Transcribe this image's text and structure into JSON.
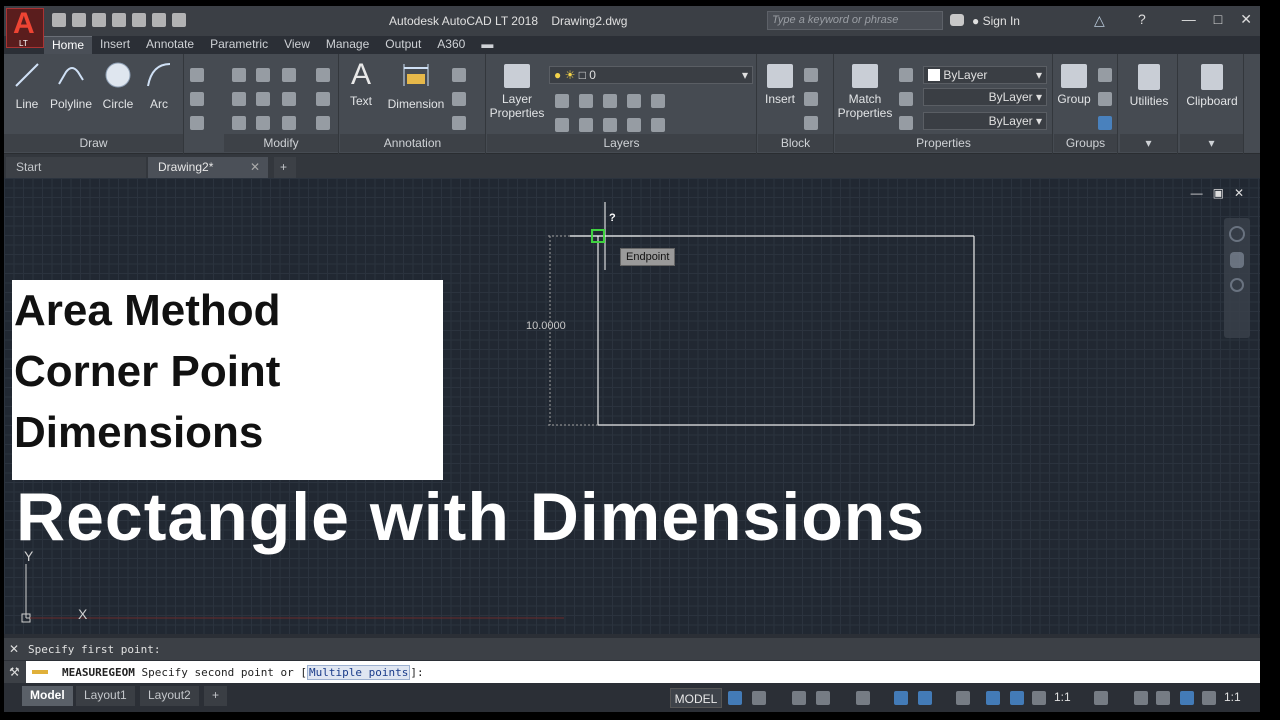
{
  "window": {
    "app_title": "Autodesk AutoCAD LT 2018",
    "file_name": "Drawing2.dwg",
    "search_placeholder": "Type a keyword or phrase",
    "sign_in": "Sign In",
    "logo_letter": "A",
    "logo_sub": "LT"
  },
  "ribbon_tabs": [
    "Home",
    "Insert",
    "Annotate",
    "Parametric",
    "View",
    "Manage",
    "Output",
    "A360"
  ],
  "draw_panel": {
    "label": "Draw",
    "tools": [
      "Line",
      "Polyline",
      "Circle",
      "Arc"
    ]
  },
  "modify_panel": {
    "label": "Modify"
  },
  "annotation_panel": {
    "label": "Annotation",
    "tools": [
      "Text",
      "Dimension"
    ]
  },
  "layers_panel": {
    "label": "Layers",
    "layer_properties": "Layer Properties",
    "current_layer": "0"
  },
  "block_panel": {
    "label": "Block",
    "insert": "Insert"
  },
  "properties_panel": {
    "label": "Properties",
    "match": "Match Properties",
    "color": "ByLayer",
    "linetype": "ByLayer",
    "lineweight": "ByLayer"
  },
  "groups_panel": {
    "label": "Groups",
    "group": "Group"
  },
  "utilities": {
    "label": "Utilities"
  },
  "clipboard": {
    "label": "Clipboard"
  },
  "file_tabs": {
    "start": "Start",
    "drawing": "Drawing2*"
  },
  "canvas": {
    "overlay_lines": [
      "Area Method",
      "Corner Point",
      "Dimensions"
    ],
    "big_title": "Rectangle with Dimensions",
    "tooltip": "Endpoint",
    "dimension": "10.0000",
    "cursor_mark": "?",
    "ucs_y": "Y",
    "ucs_x": "X"
  },
  "command": {
    "history": "Specify first point:",
    "command_name": "MEASUREGEOM",
    "prompt_before": " Specify second point or [",
    "option": "Multiple points",
    "prompt_after": "]:"
  },
  "status": {
    "layout_tabs": [
      "Model",
      "Layout1",
      "Layout2"
    ],
    "model_button": "MODEL",
    "scale1": "1:1",
    "scale2": "1:1"
  }
}
